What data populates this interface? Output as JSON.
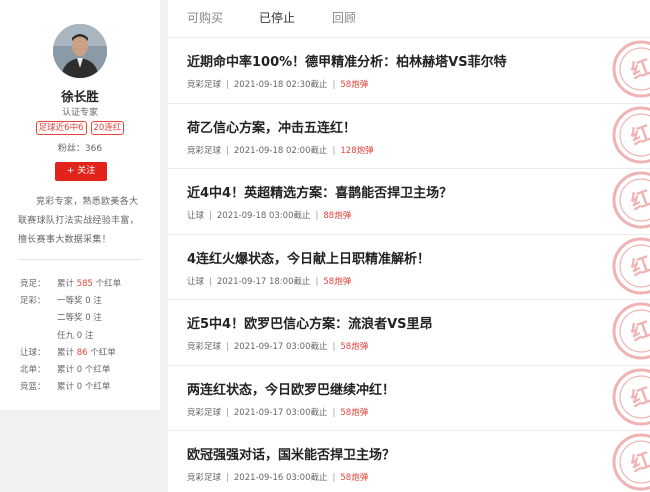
{
  "profile": {
    "name": "徐长胜",
    "subtitle": "认证专家",
    "badges": [
      "足球近6中6",
      "20连红"
    ],
    "fans": "粉丝：366",
    "follow_label": "+ 关注",
    "bio": "竞彩专家，熟悉欧美各大联赛球队打法实战经验丰富，擅长赛事大数据采集！",
    "stats": [
      {
        "label": "竞足：",
        "pre": "累计 ",
        "num": "585",
        "post": " 个红单",
        "red": true
      },
      {
        "label": "足彩：",
        "pre": "一等奖 ",
        "num": "0",
        "post": " 注",
        "red": false
      },
      {
        "label": "",
        "pre": "二等奖 ",
        "num": "0",
        "post": " 注",
        "red": false
      },
      {
        "label": "",
        "pre": "任九 ",
        "num": "0",
        "post": " 注",
        "red": false
      },
      {
        "label": "让球：",
        "pre": "累计 ",
        "num": "86",
        "post": " 个红单",
        "red": true
      },
      {
        "label": "北单：",
        "pre": "累计 ",
        "num": "0",
        "post": " 个红单",
        "red": false
      },
      {
        "label": "竞篮：",
        "pre": "累计 ",
        "num": "0",
        "post": " 个红单",
        "red": false
      }
    ]
  },
  "tabs": [
    "可购买",
    "已停止",
    "回顾"
  ],
  "active_tab_index": 1,
  "articles": [
    {
      "title": "近期命中率100%！德甲精准分析：柏林赫塔VS菲尔特",
      "category": "竞彩足球",
      "time": "2021-09-18 02:30截止",
      "price": "58炮弹"
    },
    {
      "title": "荷乙信心方案，冲击五连红！",
      "category": "竞彩足球",
      "time": "2021-09-18 02:00截止",
      "price": "128炮弹"
    },
    {
      "title": "近4中4！英超精选方案：喜鹊能否捍卫主场？",
      "category": "让球",
      "time": "2021-09-18 03:00截止",
      "price": "88炮弹"
    },
    {
      "title": "4连红火爆状态，今日献上日职精准解析！",
      "category": "让球",
      "time": "2021-09-17 18:00截止",
      "price": "58炮弹"
    },
    {
      "title": "近5中4！欧罗巴信心方案：流浪者VS里昂",
      "category": "竞彩足球",
      "time": "2021-09-17 03:00截止",
      "price": "58炮弹"
    },
    {
      "title": "两连红状态，今日欧罗巴继续冲红！",
      "category": "竞彩足球",
      "time": "2021-09-17 03:00截止",
      "price": "58炮弹"
    },
    {
      "title": "欧冠强强对话，国米能否捍卫主场？",
      "category": "竞彩足球",
      "time": "2021-09-16 03:00截止",
      "price": "58炮弹"
    }
  ],
  "stamp_text": "红",
  "colors": {
    "accent": "#e2231a",
    "stamp": "#f0b3b3",
    "background": "#f2f2f2"
  }
}
